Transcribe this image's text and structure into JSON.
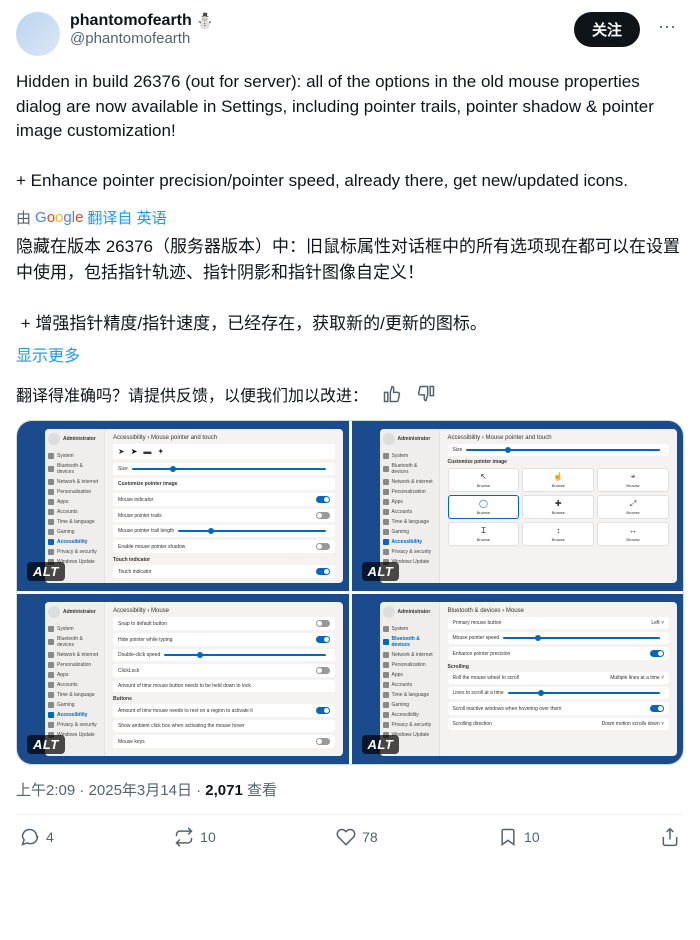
{
  "user": {
    "display_name": "phantomofearth",
    "emoji": "⛄",
    "handle": "@phantomofearth"
  },
  "buttons": {
    "follow": "关注",
    "more": "···",
    "alt_badge": "ALT"
  },
  "tweet": {
    "text": "Hidden in build 26376 (out for server): all of the options in the old mouse properties dialog are now available in Settings, including pointer trails, pointer shadow & pointer image customization!\n\n+ Enhance pointer precision/pointer speed, already there, get new/updated icons."
  },
  "translation": {
    "by_label": "由",
    "google": "Google",
    "translated_from": "翻译自 英语",
    "text": "隐藏在版本 26376（服务器版本）中：旧鼠标属性对话框中的所有选项现在都可以在设置中使用，包括指针轨迹、指针阴影和指针图像自定义！\n\n + 增强指针精度/指针速度，已经存在，获取新的/更新的图标。",
    "show_more": "显示更多"
  },
  "feedback": {
    "prompt": "翻译得准确吗？请提供反馈，以便我们加以改进："
  },
  "screenshots": {
    "nav": [
      "System",
      "Bluetooth & devices",
      "Network & internet",
      "Personalization",
      "Apps",
      "Accounts",
      "Time & language",
      "Gaming",
      "Accessibility",
      "Privacy & security",
      "Windows Update"
    ],
    "admin": "Administrator",
    "bc1": "Accessibility › Mouse pointer and touch",
    "bc2": "Accessibility › Mouse",
    "bc3": "Bluetooth & devices › Mouse",
    "browse": "Browse",
    "size": "Size",
    "custom_img": "Customize pointer image",
    "touch_ind": "Touch indicator"
  },
  "meta": {
    "time": "上午2:09",
    "date": "2025年3月14日",
    "views_count": "2,071",
    "views_label": "查看"
  },
  "actions": {
    "reply_count": "4",
    "retweet_count": "10",
    "like_count": "78",
    "bookmark_count": "10"
  }
}
